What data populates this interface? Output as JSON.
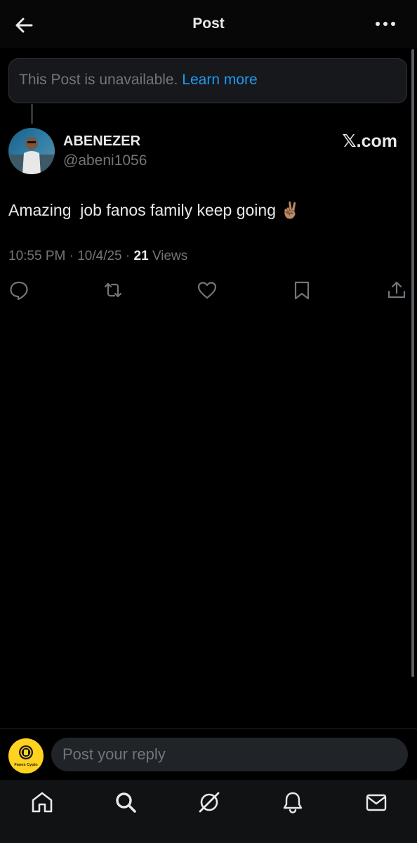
{
  "header": {
    "title": "Post",
    "back_icon": "arrow-left-icon",
    "more_icon": "more-horizontal-icon"
  },
  "notice": {
    "text": "This Post is unavailable.",
    "link": "Learn more"
  },
  "post": {
    "display_name": "ABENEZER",
    "handle": "@abeni1056",
    "badge": "𝕏.com",
    "text": "Amazing  job fanos family keep going ✌🏽",
    "time": "10:55 PM",
    "date": "10/4/25",
    "views_count": "21",
    "views_label": "Views",
    "actions": [
      "reply-icon",
      "repost-icon",
      "like-icon",
      "bookmark-icon",
      "share-icon"
    ]
  },
  "reply": {
    "placeholder": "Post your reply",
    "avatar_label": "Fanos Cypto"
  },
  "tabbar": [
    "home-icon",
    "search-icon",
    "grok-icon",
    "notifications-icon",
    "messages-icon"
  ],
  "colors": {
    "background": "#000000",
    "text": "#e7e9ea",
    "muted": "#71767b",
    "link": "#1d9bf0",
    "accent": "#ffd21f"
  }
}
